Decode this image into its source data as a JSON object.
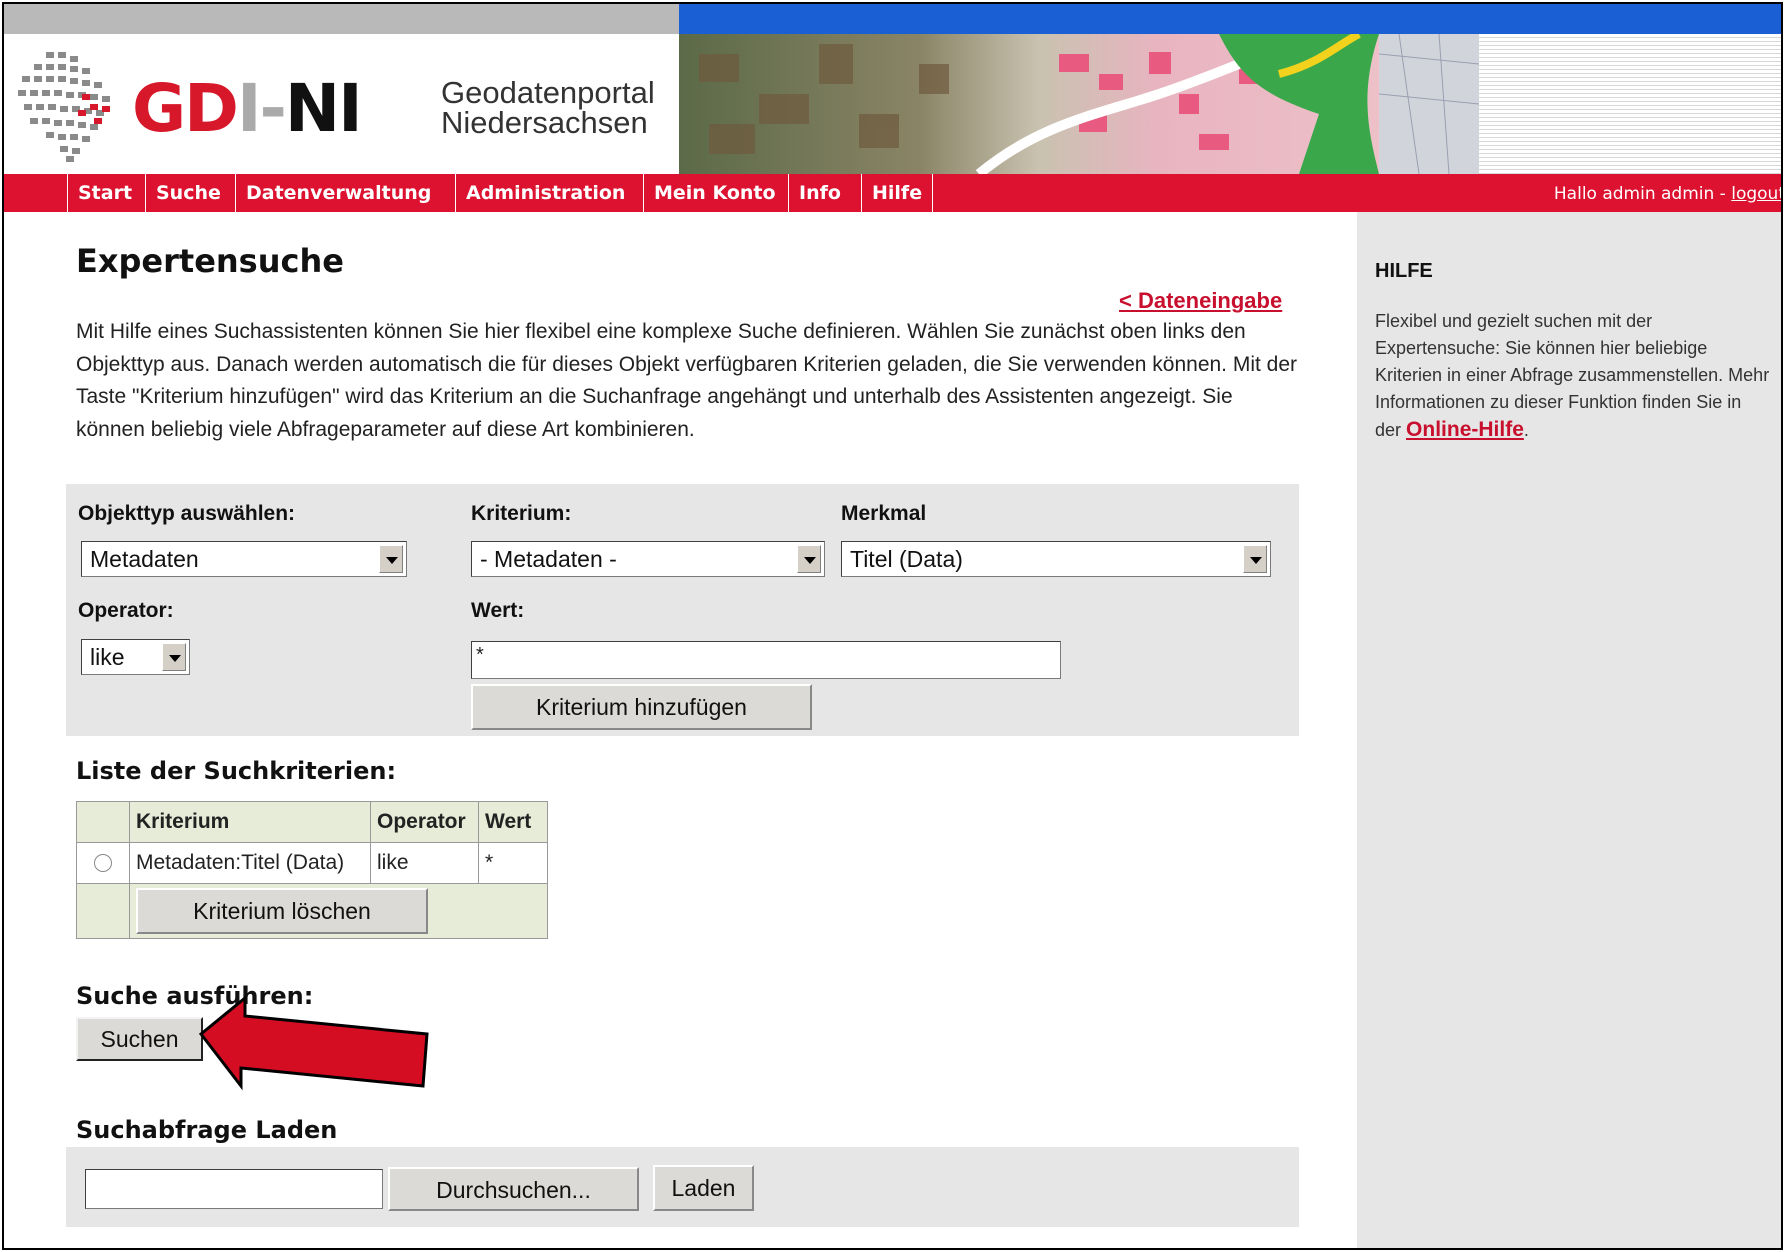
{
  "header": {
    "brand_g": "GD",
    "brand_dash": "I-",
    "brand_n": "NI",
    "portal_line1": "Geodatenportal",
    "portal_line2": "Niedersachsen"
  },
  "nav": {
    "items": [
      "Start",
      "Suche",
      "Datenverwaltung",
      "Administration",
      "Mein Konto",
      "Info",
      "Hilfe"
    ],
    "greeting": "Hallo admin admin - ",
    "logout": "logout"
  },
  "page": {
    "title": "Expertensuche",
    "back_link": "< Dateneingabe",
    "intro": "Mit Hilfe eines Suchassistenten können Sie hier flexibel eine komplexe Suche definieren. Wählen Sie zunächst oben links den Objekttyp aus. Danach werden automatisch die für dieses Objekt verfügbaren Kriterien geladen, die Sie verwenden können. Mit der Taste \"Kriterium hinzufügen\" wird das Kriterium an die Suchanfrage angehängt und unterhalb des Assistenten angezeigt. Sie können beliebig viele Abfrageparameter auf diese Art kombinieren."
  },
  "form": {
    "objekttyp_label": "Objekttyp auswählen:",
    "objekttyp_value": "Metadaten",
    "kriterium_label": "Kriterium:",
    "kriterium_value": "- Metadaten -",
    "merkmal_label": "Merkmal",
    "merkmal_value": "Titel (Data)",
    "operator_label": "Operator:",
    "operator_value": "like",
    "wert_label": "Wert:",
    "wert_value": "*",
    "add_button": "Kriterium hinzufügen"
  },
  "criteria": {
    "heading": "Liste der Suchkriterien:",
    "columns": [
      "Kriterium",
      "Operator",
      "Wert"
    ],
    "rows": [
      {
        "kriterium": "Metadaten:Titel (Data)",
        "operator": "like",
        "wert": "*"
      }
    ],
    "delete_button": "Kriterium löschen"
  },
  "search": {
    "heading": "Suche ausführen:",
    "button": "Suchen"
  },
  "load": {
    "heading": "Suchabfrage Laden",
    "file_value": "",
    "browse_button": "Durchsuchen...",
    "load_button": "Laden"
  },
  "sidebar": {
    "title": "HILFE",
    "text": "Flexibel und gezielt suchen mit der Expertensuche: Sie können hier beliebige Kriterien in einer Abfrage zusammenstellen. Mehr Informationen zu dieser Funktion finden Sie in der ",
    "link": "Online-Hilfe",
    "text_end": "."
  },
  "colors": {
    "brand_red": "#dc1230",
    "link_red": "#c8102e",
    "top_blue": "#1a5fd4",
    "panel_gray": "#e6e6e6",
    "annotation_arrow": "#d40d22"
  }
}
